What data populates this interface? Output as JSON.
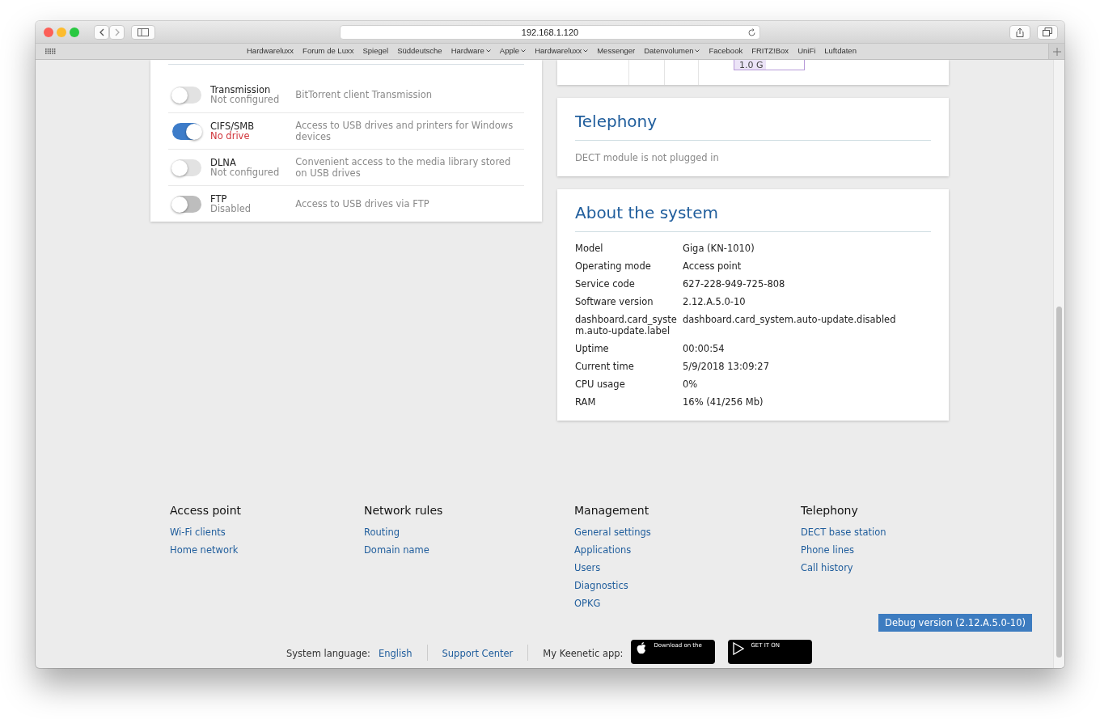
{
  "browser": {
    "url": "192.168.1.120",
    "bookmarks": [
      {
        "label": "Hardwareluxx",
        "menu": false
      },
      {
        "label": "Forum de Luxx",
        "menu": false
      },
      {
        "label": "Spiegel",
        "menu": false
      },
      {
        "label": "Süddeutsche",
        "menu": false
      },
      {
        "label": "Hardware",
        "menu": true
      },
      {
        "label": "Apple",
        "menu": true
      },
      {
        "label": "Hardwareluxx",
        "menu": true
      },
      {
        "label": "Messenger",
        "menu": false
      },
      {
        "label": "Datenvolumen",
        "menu": true
      },
      {
        "label": "Facebook",
        "menu": false
      },
      {
        "label": "FRITZ!Box",
        "menu": false
      },
      {
        "label": "UniFi",
        "menu": false
      },
      {
        "label": "Luftdaten",
        "menu": false
      }
    ]
  },
  "apps": [
    {
      "name": "Transmission",
      "status": "Not configured",
      "alert": false,
      "on": false,
      "disabled": false,
      "description": "BitTorrent client Transmission"
    },
    {
      "name": "CIFS/SMB",
      "status": "No drive",
      "alert": true,
      "on": true,
      "disabled": false,
      "description": "Access to USB drives and printers for Windows devices"
    },
    {
      "name": "DLNA",
      "status": "Not configured",
      "alert": false,
      "on": false,
      "disabled": false,
      "description": "Convenient access to the media library stored on USB drives"
    },
    {
      "name": "FTP",
      "status": "Disabled",
      "alert": false,
      "on": false,
      "disabled": true,
      "description": "Access to USB drives via FTP"
    }
  ],
  "chart_fragment": {
    "label": "1.0 G"
  },
  "telephony": {
    "title": "Telephony",
    "message": "DECT module is not plugged in"
  },
  "system": {
    "title": "About the system",
    "rows": [
      {
        "label": "Model",
        "value": "Giga (KN-1010)"
      },
      {
        "label": "Operating mode",
        "value": "Access point"
      },
      {
        "label": "Service code",
        "value": "627-228-949-725-808"
      },
      {
        "label": "Software version",
        "value": "2.12.A.5.0-10"
      },
      {
        "label": "dashboard.card_system.auto-update.label",
        "value": "dashboard.card_system.auto-update.disabled"
      },
      {
        "label": "Uptime",
        "value": "00:00:54"
      },
      {
        "label": "Current time",
        "value": "5/9/2018 13:09:27"
      },
      {
        "label": "CPU usage",
        "value": "0%"
      },
      {
        "label": "RAM",
        "value": "16% (41/256 Mb)"
      }
    ]
  },
  "footer": {
    "columns": [
      {
        "heading": "Access point",
        "links": [
          "Wi-Fi clients",
          "Home network"
        ]
      },
      {
        "heading": "Network rules",
        "links": [
          "Routing",
          "Domain name"
        ]
      },
      {
        "heading": "Management",
        "links": [
          "General settings",
          "Applications",
          "Users",
          "Diagnostics",
          "OPKG"
        ]
      },
      {
        "heading": "Telephony",
        "links": [
          "DECT base station",
          "Phone lines",
          "Call history"
        ]
      }
    ],
    "debug": "Debug version (2.12.A.5.0-10)",
    "bottom": {
      "language_label": "System language:",
      "language": "English",
      "support": "Support Center",
      "app_label": "My Keenetic app:",
      "app_store": "Download on the",
      "google_play": "GET IT ON"
    }
  }
}
